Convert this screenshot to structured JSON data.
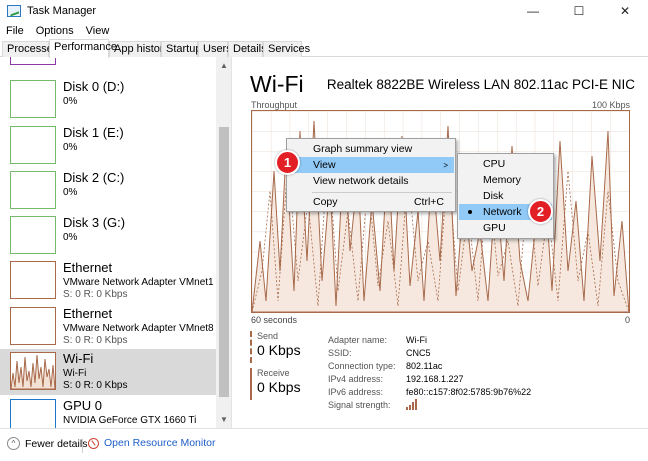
{
  "window": {
    "title": "Task Manager",
    "minimize_glyph": "—",
    "maximize_glyph": "☐",
    "close_glyph": "✕"
  },
  "menu": [
    "File",
    "Options",
    "View"
  ],
  "tabs": [
    "Processes",
    "Performance",
    "App history",
    "Startup",
    "Users",
    "Details",
    "Services"
  ],
  "active_tab": "Performance",
  "sidebar": {
    "items": [
      {
        "name": "Disk 0 (D:)",
        "line1": "0%",
        "line2": "",
        "icon": "disk-graph-icon"
      },
      {
        "name": "Disk 1 (E:)",
        "line1": "0%",
        "line2": "",
        "icon": "disk-graph-icon"
      },
      {
        "name": "Disk 2 (C:)",
        "line1": "0%",
        "line2": "",
        "icon": "disk-graph-icon"
      },
      {
        "name": "Disk 3 (G:)",
        "line1": "0%",
        "line2": "",
        "icon": "disk-graph-icon"
      },
      {
        "name": "Ethernet",
        "line1": "VMware Network Adapter VMnet1",
        "line2": "S: 0 R: 0 Kbps",
        "icon": "ethernet-graph-icon"
      },
      {
        "name": "Ethernet",
        "line1": "VMware Network Adapter VMnet8",
        "line2": "S: 0 R: 0 Kbps",
        "icon": "ethernet-graph-icon"
      },
      {
        "name": "Wi-Fi",
        "line1": "Wi-Fi",
        "line2": "S: 0 R: 0 Kbps",
        "icon": "wifi-graph-icon"
      },
      {
        "name": "GPU 0",
        "line1": "NVIDIA GeForce GTX 1660 Ti",
        "line2": "",
        "icon": "gpu-graph-icon"
      }
    ],
    "selected": "Wi-Fi"
  },
  "main": {
    "title": "Wi-Fi",
    "adapter": "Realtek 8822BE Wireless LAN 802.11ac PCI-E NIC",
    "throughput_label": "Throughput",
    "max_label": "100 Kbps",
    "time_left": "60 seconds",
    "time_right": "0",
    "send_label": "Send",
    "send_value": "0 Kbps",
    "receive_label": "Receive",
    "receive_value": "0 Kbps",
    "details": [
      {
        "label": "Adapter name:",
        "value": "Wi-Fi"
      },
      {
        "label": "SSID:",
        "value": "CNC5"
      },
      {
        "label": "Connection type:",
        "value": "802.11ac"
      },
      {
        "label": "IPv4 address:",
        "value": "192.168.1.227"
      },
      {
        "label": "IPv6 address:",
        "value": "fe80::c157:8f02:5785:9b76%22"
      },
      {
        "label": "Signal strength:",
        "value": ""
      }
    ],
    "signal_bars": 4,
    "accent": "#a7694a"
  },
  "context_menu": {
    "items": [
      {
        "label": "Graph summary view",
        "shortcut": "",
        "submenu": false
      },
      {
        "label": "View",
        "shortcut": "",
        "submenu": true
      },
      {
        "label": "View network details",
        "shortcut": "",
        "submenu": false
      },
      {
        "label": "Copy",
        "shortcut": "Ctrl+C",
        "submenu": false
      }
    ],
    "highlighted": "View",
    "submenu_items": [
      "CPU",
      "Memory",
      "Disk",
      "Network",
      "GPU"
    ],
    "submenu_selected": "Network",
    "highlight_color": "#91c9f7"
  },
  "badges": [
    "1",
    "2"
  ],
  "statusbar": {
    "fewer_details": "Fewer details",
    "open_resource_monitor": "Open Resource Monitor"
  }
}
